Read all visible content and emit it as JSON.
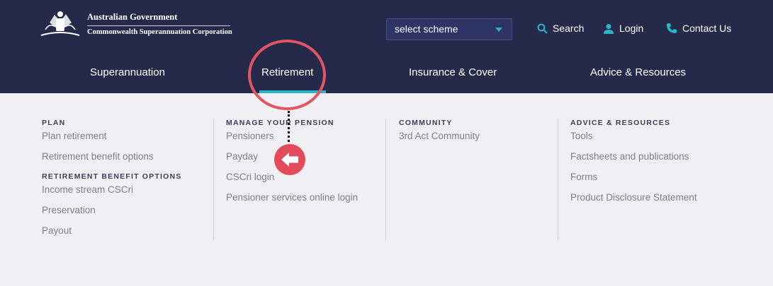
{
  "header": {
    "gov_line1": "Australian Government",
    "gov_line2": "Commonwealth Superannuation Corporation",
    "scheme_select": "select scheme",
    "search_label": "Search",
    "login_label": "Login",
    "contact_label": "Contact Us"
  },
  "nav": {
    "superannuation": "Superannuation",
    "retirement": "Retirement",
    "insurance": "Insurance & Cover",
    "advice": "Advice & Resources"
  },
  "menu": {
    "plan_title": "PLAN",
    "plan_links": [
      "Plan retirement",
      "Retirement benefit options"
    ],
    "rbo_title": "RETIREMENT BENEFIT OPTIONS",
    "rbo_links": [
      "Income stream CSCri",
      "Preservation",
      "Payout"
    ],
    "manage_title": "MANAGE YOUR PENSION",
    "manage_links": [
      "Pensioners",
      "Payday",
      "CSCri login",
      "Pensioner services online login"
    ],
    "community_title": "COMMUNITY",
    "community_links": [
      "3rd Act Community"
    ],
    "advice_title": "ADVICE & RESOURCES",
    "advice_links": [
      "Tools",
      "Factsheets and publications",
      "Forms",
      "Product Disclosure Statement"
    ]
  },
  "colors": {
    "navy": "#262a4a",
    "accent": "#2bb5c9",
    "highlight": "#e34b5a",
    "menu_bg": "#efeff4"
  },
  "icons": [
    "coat-of-arms-icon",
    "chevron-down-icon",
    "search-icon",
    "user-icon",
    "phone-icon",
    "arrow-left-icon"
  ]
}
